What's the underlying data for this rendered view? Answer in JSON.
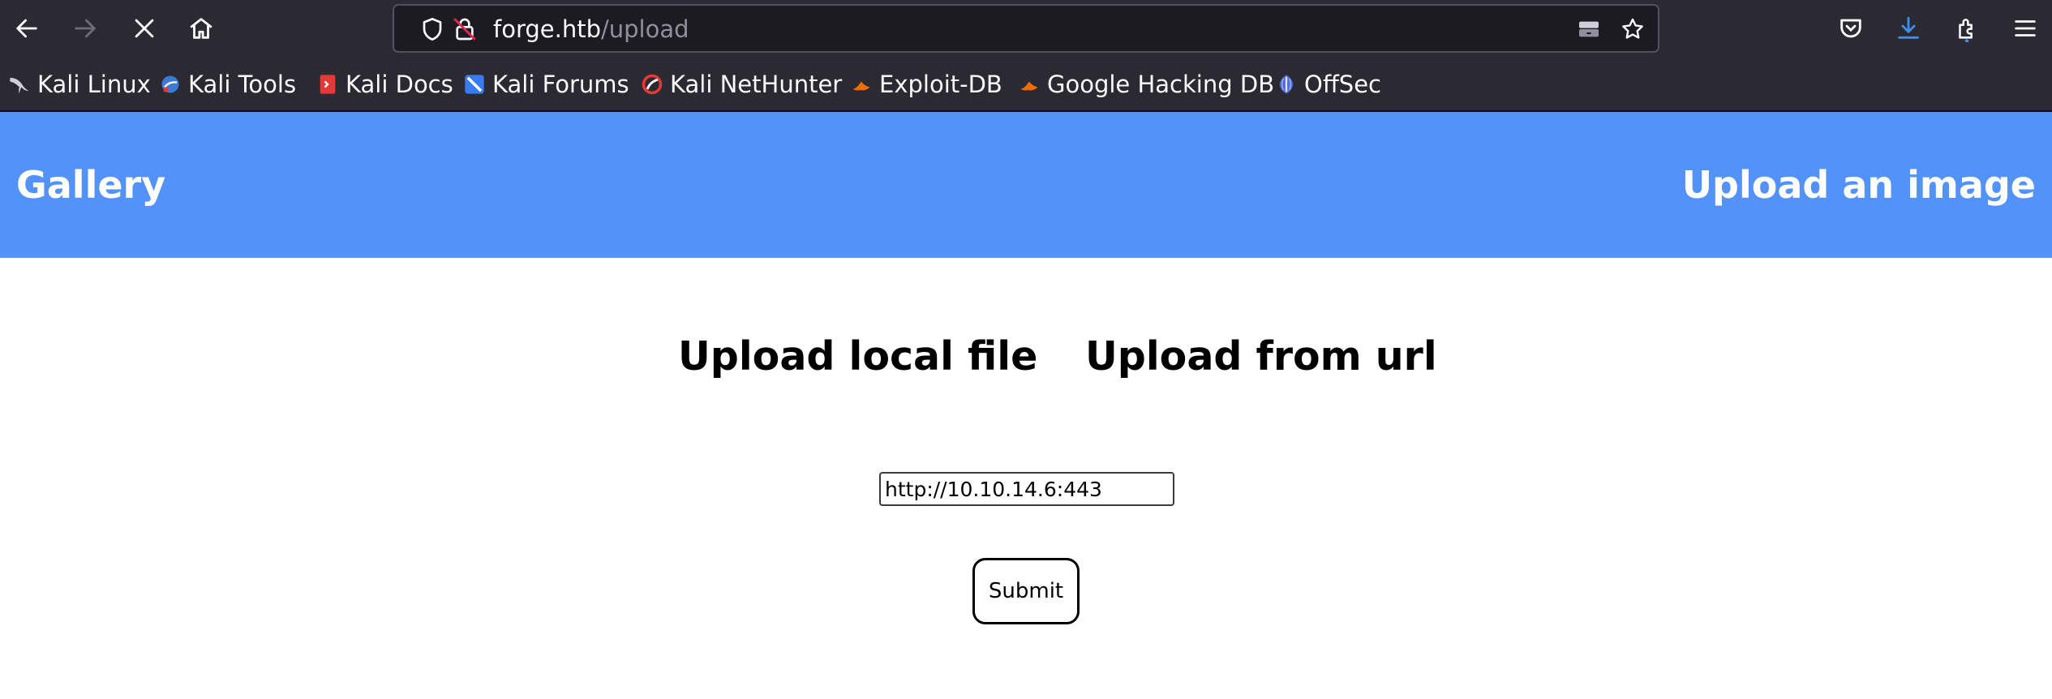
{
  "browser": {
    "url_host": "forge.htb",
    "url_path": "/upload",
    "bookmarks": [
      {
        "label": "Kali Linux",
        "icon": "kali-dragon-icon"
      },
      {
        "label": "Kali Tools",
        "icon": "kali-tools-icon"
      },
      {
        "label": "Kali Docs",
        "icon": "kali-docs-icon"
      },
      {
        "label": "Kali Forums",
        "icon": "kali-forums-icon"
      },
      {
        "label": "Kali NetHunter",
        "icon": "kali-nethunter-icon"
      },
      {
        "label": "Exploit-DB",
        "icon": "exploit-db-icon"
      },
      {
        "label": "Google Hacking DB",
        "icon": "google-hacking-db-icon"
      },
      {
        "label": "OffSec",
        "icon": "offsec-icon"
      }
    ],
    "colors": {
      "chrome": "#2b2a33",
      "urlbar": "#1c1b22",
      "download_accent": "#3d8fe8"
    }
  },
  "site": {
    "header": {
      "brand": "Gallery",
      "upload_link": "Upload an image",
      "color": "#5393f9"
    },
    "tabs": {
      "local": "Upload local file",
      "url": "Upload from url"
    },
    "form": {
      "url_value": "http://10.10.14.6:443",
      "submit_label": "Submit"
    }
  }
}
